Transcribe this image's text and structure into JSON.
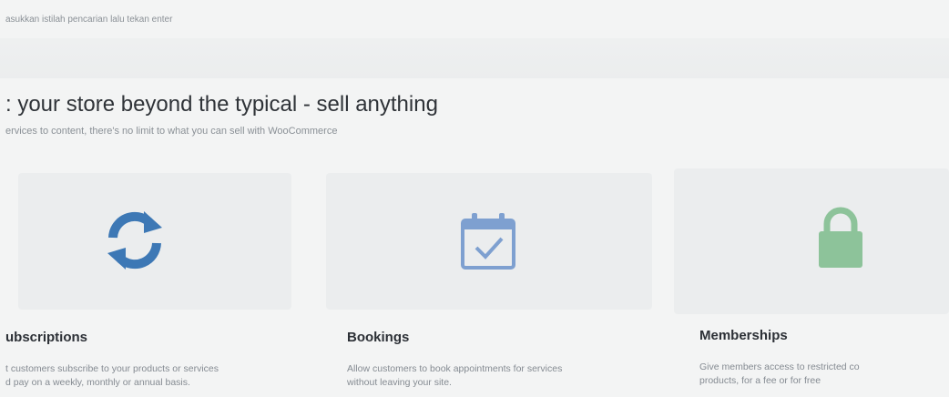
{
  "search": {
    "hint": "asukkan istilah pencarian lalu tekan enter"
  },
  "hero": {
    "title": ": your store beyond the typical - sell anything",
    "subtitle": "ervices to content, there's no limit to what you can sell with WooCommerce"
  },
  "features": [
    {
      "title": "ubscriptions",
      "line1": "t customers subscribe to your products or services",
      "line2": "d pay on a weekly, monthly or annual basis.",
      "icon": "refresh-icon",
      "color": "#3d78b5"
    },
    {
      "title": "Bookings",
      "line1": "Allow customers to book appointments for services",
      "line2": "without leaving your site.",
      "icon": "calendar-check-icon",
      "color": "#7ea0d0"
    },
    {
      "title": "Memberships",
      "line1": "Give members access to restricted co",
      "line2": "products, for a fee or for free",
      "icon": "lock-icon",
      "color": "#8dc39a"
    }
  ]
}
